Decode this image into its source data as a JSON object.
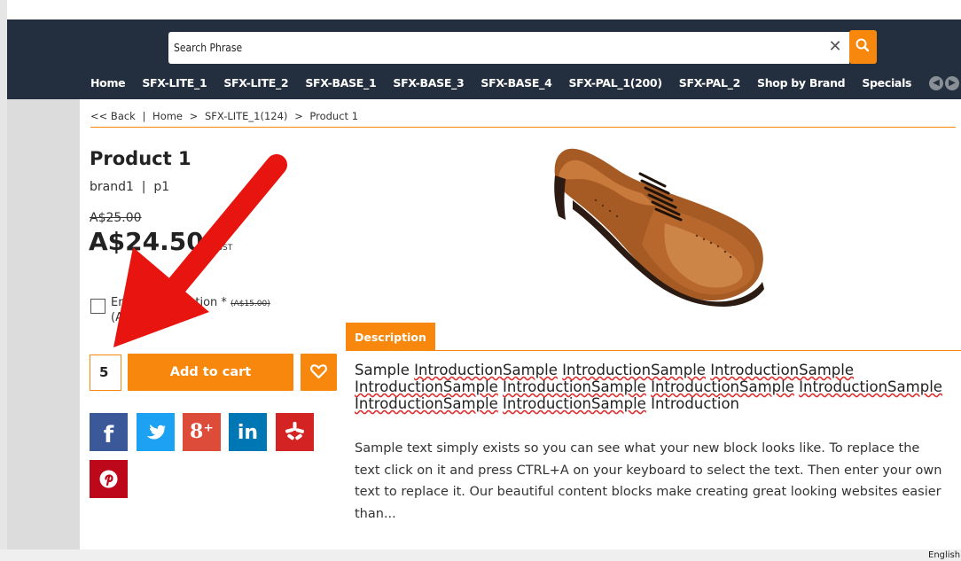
{
  "search": {
    "placeholder": "Search Phrase",
    "value": "Search Phrase"
  },
  "nav": [
    "Home",
    "SFX-LITE_1",
    "SFX-LITE_2",
    "SFX-BASE_1",
    "SFX-BASE_3",
    "SFX-BASE_4",
    "SFX-PAL_1(200)",
    "SFX-PAL_2",
    "Shop by Brand",
    "Specials"
  ],
  "breadcrumb": {
    "back": "<< Back",
    "sep1": "|",
    "home": "Home",
    "sep2": ">",
    "category": "SFX-LITE_1(124)",
    "sep3": ">",
    "current": "Product 1"
  },
  "product": {
    "title": "Product 1",
    "brand_line": "brand1  |  p1",
    "old_price": "A$25.00",
    "price": "A$24.50",
    "price_note": "inc GST",
    "option_label": "Embroidery option *",
    "option_old_price": "(A$15.00)",
    "option_price": "(A$14.70)",
    "quantity": "5",
    "add_to_cart": "Add to cart"
  },
  "tabs": {
    "description": "Description"
  },
  "description": {
    "intro_words": [
      "Sample ",
      "IntroductionSample",
      " ",
      "IntroductionSample",
      " ",
      "IntroductionSample",
      " ",
      "IntroductionSample",
      " ",
      "IntroductionSample",
      " ",
      "IntroductionSample",
      " ",
      "IntroductionSample",
      " ",
      "IntroductionSample",
      " ",
      "IntroductionSample",
      " Introduction"
    ],
    "body": "Sample text simply exists so you can see what your new block looks like. To replace the text click on it and press CTRL+A on your keyboard to select the text. Then enter your own text to replace it. Our beautiful content blocks make creating great looking websites easier than..."
  },
  "footer": {
    "language": "English"
  },
  "icons": {
    "search": "search-icon",
    "clear": "close-icon",
    "wishlist": "heart-icon",
    "prev": "chevron-left-icon",
    "next": "chevron-right-icon"
  },
  "colors": {
    "accent": "#f7870d",
    "header": "#232f3e",
    "facebook": "#3b5998",
    "twitter": "#1da1f2",
    "googleplus": "#dd4b39",
    "linkedin": "#0077b5",
    "yelp": "#d32323",
    "pinterest": "#bd081c",
    "annotation_arrow": "#e8140f"
  }
}
